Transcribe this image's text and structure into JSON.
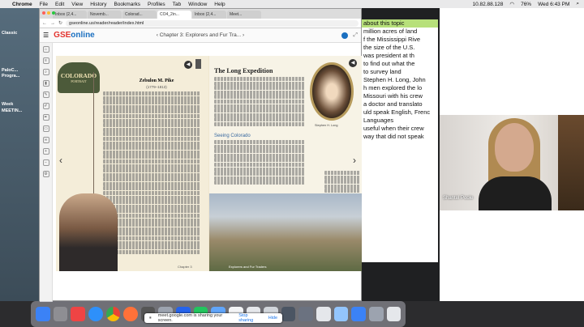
{
  "menubar": {
    "app": "Chrome",
    "items": [
      "File",
      "Edit",
      "View",
      "History",
      "Bookmarks",
      "Profiles",
      "Tab",
      "Window",
      "Help"
    ],
    "ip": "10.82.88.128",
    "battery": "76%",
    "clock": "Wed 6:43 PM"
  },
  "desktop": {
    "labels": [
      "Classic",
      "PaloC...",
      "Progra...",
      "Week",
      "MEETIN..."
    ]
  },
  "browser": {
    "tabs": [
      "Inbox (2,4...",
      "Novemb...",
      "Colorad...",
      "CO4_2in...",
      "Inbox (2,4...",
      "Meet..."
    ],
    "url": "gseonline.us/reader/reader/index.html"
  },
  "reader": {
    "logo_prefix": "GSE",
    "logo_suffix": "online",
    "chapter": "Chapter 3: Explorers and Fur Tra...",
    "left_page": {
      "badge": "COLORADO",
      "badge_sub": "PORTRAIT",
      "title": "Zebulon M. Pike",
      "dates": "(1779–1813)",
      "footer": "Chapter 3"
    },
    "right_page": {
      "title": "The Long Expedition",
      "subhead": "Seeing Colorado",
      "portrait_caption": "Stephen H. Long",
      "footer": "Explorers and Fur Traders"
    }
  },
  "doc": {
    "lines": [
      "about this topic",
      "million acres of land",
      "f the Mississippi Rive",
      "the size of the U.S.",
      "was president at th",
      "",
      "",
      "to find out what the",
      "",
      "to survey land",
      "Stephen H. Long, John",
      "h men explored the lo",
      "",
      "Missouri with his crew",
      "a doctor and translato",
      "uld speak English, Frenc",
      "Languages",
      "useful when their crew",
      "way that did not speak"
    ]
  },
  "meet": {
    "participant": "Shantel Poole"
  },
  "share_bar": {
    "text": "meet.google.com is sharing your screen.",
    "stop": "Stop sharing",
    "hide": "Hide"
  },
  "colors": {
    "logo_blue": "#1a6fc0",
    "highlight": "#b7e07a",
    "badge_green": "#4c5a3a"
  }
}
